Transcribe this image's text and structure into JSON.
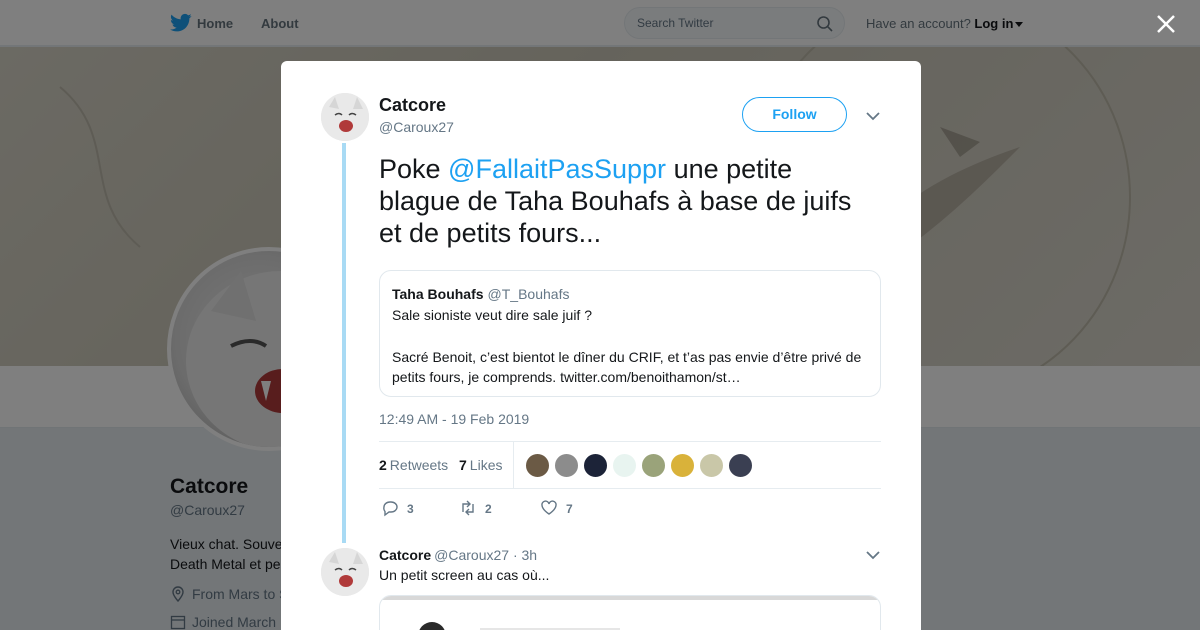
{
  "nav": {
    "home_label": "Home",
    "about_label": "About",
    "search_placeholder": "Search Twitter",
    "account_prompt": "Have an account?",
    "login_label": "Log in"
  },
  "profile": {
    "name": "Catcore",
    "handle": "@Caroux27",
    "bio": "Vieux chat. Souve... Death Metal et pe...",
    "bio_line1": "Vieux chat. Souve",
    "bio_line2": "Death Metal et pe",
    "location": "From Mars to S",
    "joined": "Joined March"
  },
  "tweet": {
    "author_name": "Catcore",
    "author_handle": "@Caroux27",
    "follow_label": "Follow",
    "text_before": "Poke ",
    "mention": "@FallaitPasSuppr",
    "text_after": " une petite blague de Taha Bouhafs à base de juifs et de petits fours...",
    "quote": {
      "name": "Taha Bouhafs",
      "handle": "@T_Bouhafs",
      "line1": "Sale sioniste veut dire sale juif ?",
      "line2": "Sacré Benoit, c’est bientot le dîner du CRIF, et t’as pas envie d’être privé de petits fours, je comprends. twitter.com/benoithamon/st…"
    },
    "timestamp": "12:49 AM - 19 Feb 2019",
    "retweets_count": "2",
    "retweets_label": "Retweets",
    "likes_count": "7",
    "likes_label": "Likes",
    "likers": [
      "#6b5a45",
      "#8c8c8c",
      "#1c2338",
      "#e8f4f0",
      "#9aa37a",
      "#d9b23a",
      "#c9c7a8",
      "#3a3f52"
    ],
    "actions": {
      "replies": "3",
      "retweets": "2",
      "likes": "7"
    }
  },
  "reply": {
    "author_name": "Catcore",
    "author_handle": "@Caroux27 · 3h",
    "text": "Un petit screen au cas où..."
  },
  "colors": {
    "accent": "#1da1f2",
    "thread_line": "#a8daf4"
  }
}
